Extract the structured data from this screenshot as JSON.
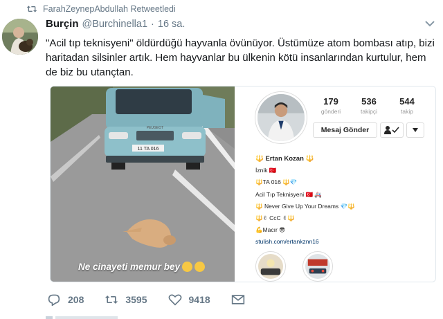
{
  "retweet": {
    "icon": "retweet-icon",
    "label": "FarahZeynepAbdullah Retweetledi"
  },
  "tweet": {
    "author_name": "Burçin",
    "author_handle": "@Burchinella1",
    "separator": "·",
    "time": "16 sa.",
    "text": "\"Acil tıp teknisyeni\" öldürdüğü hayvanla övünüyor. Üstümüze atom bombası atıp, bizi haritadan silsinler artık. Hem hayvanlar bu ülkenin kötü insanlarından kurtulur, hem de biz bu utançtan."
  },
  "media": {
    "photo_caption": "Ne cinayeti memur bey",
    "plate_text": "11 TA 016",
    "car_brand": "PEUGEOT",
    "profile": {
      "stats": [
        {
          "value": "179",
          "label": "gönderi"
        },
        {
          "value": "536",
          "label": "takipçi"
        },
        {
          "value": "544",
          "label": "takip"
        }
      ],
      "message_button": "Mesaj Gönder",
      "bio": {
        "name": "🔱 Ertan Kozan 🔱",
        "lines": [
          "İznik 🇹🇷",
          "🔱TA 016 🔱💎",
          "Acil Tıp Teknisyeni 🇹🇷 🚑",
          "🔱 Never Give Up Your Dreams 💎🔱",
          "🔱✌ CcC ✌🔱",
          "💪Macır 😎"
        ],
        "link": "stulish.com/ertankznn16"
      }
    }
  },
  "actions": {
    "replies": "208",
    "retweets": "3595",
    "likes": "9418"
  },
  "icons": [
    "retweet-icon",
    "chevron-down-icon",
    "reply-icon",
    "like-icon",
    "direct-message-icon",
    "follow-check-icon",
    "dropdown-caret-icon"
  ],
  "colors": {
    "text": "#14171a",
    "muted": "#657786",
    "link": "#003569",
    "border": "#e1e8ed"
  }
}
